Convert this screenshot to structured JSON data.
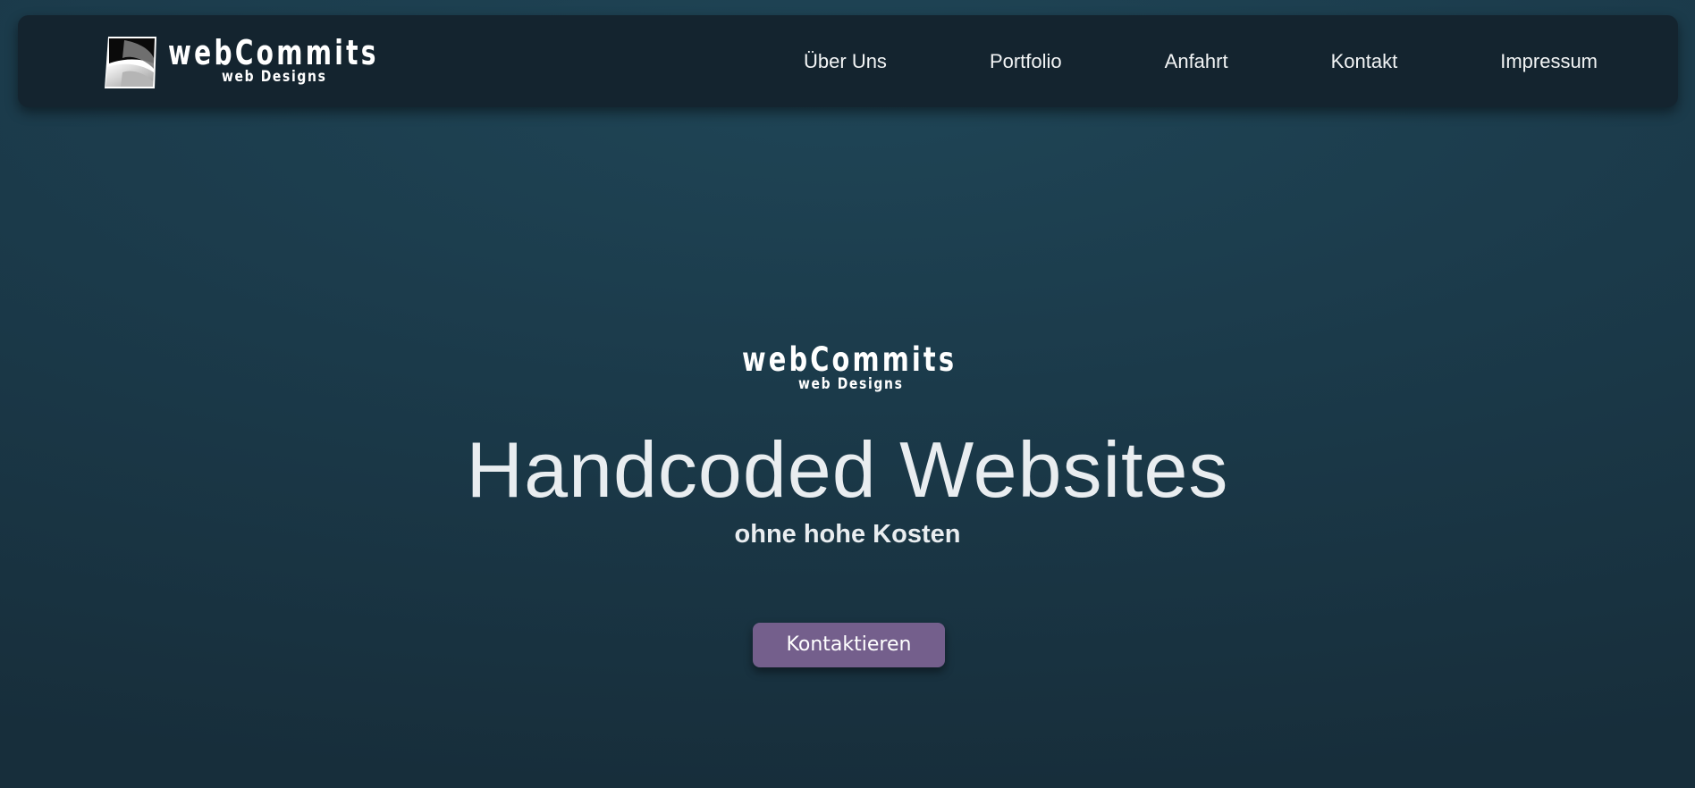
{
  "brand": {
    "name": "webCommits",
    "tagline": "web Designs",
    "logo_icon": "webcommits-logo-icon"
  },
  "nav": {
    "items": [
      {
        "label": "Über Uns"
      },
      {
        "label": "Portfolio"
      },
      {
        "label": "Anfahrt"
      },
      {
        "label": "Kontakt"
      },
      {
        "label": "Impressum"
      }
    ]
  },
  "hero": {
    "wordmark": "webCommits",
    "wordmark_tagline": "web Designs",
    "title": "Handcoded Websites",
    "subtitle": "ohne hohe Kosten",
    "cta_label": "Kontaktieren"
  },
  "colors": {
    "background": "#1b3a4a",
    "navbar": "#14242f",
    "cta": "#745f8c",
    "text": "#e9edf0"
  }
}
